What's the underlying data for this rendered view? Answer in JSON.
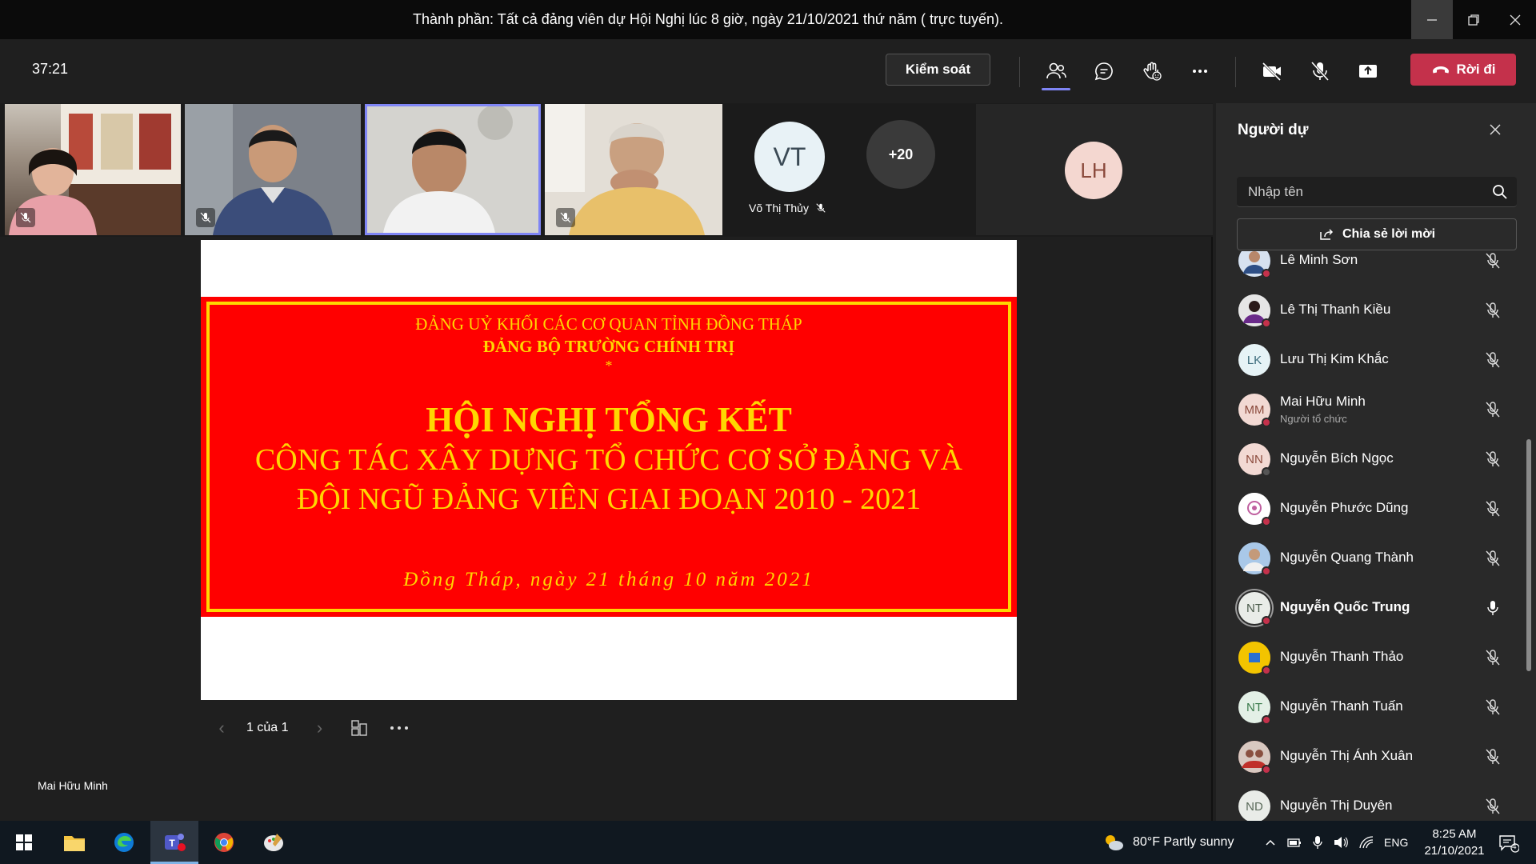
{
  "window": {
    "title": "Thành phần: Tất cả đảng viên dự Hội Nghị lúc 8 giờ, ngày 21/10/2021 thứ năm ( trực tuyến)."
  },
  "toolbar": {
    "timer": "37:21",
    "control_label": "Kiểm soát",
    "leave_label": "Rời đi"
  },
  "stage": {
    "tile_vt_initials": "VT",
    "tile_vt_name": "Võ Thị Thủy",
    "more_count": "+20",
    "tile_lh_initials": "LH",
    "presenter_name": "Mai Hữu Minh"
  },
  "slide": {
    "line1": "ĐẢNG UỶ KHỐI CÁC CƠ QUAN TỈNH ĐỒNG THÁP",
    "line2": "ĐẢNG BỘ TRƯỜNG CHÍNH TRỊ",
    "line3": "*",
    "line4": "HỘI NGHỊ TỔNG KẾT",
    "line5": "CÔNG TÁC XÂY DỰNG TỔ CHỨC CƠ SỞ ĐẢNG VÀ",
    "line6": "ĐỘI NGŨ ĐẢNG VIÊN GIAI ĐOẠN 2010 - 2021",
    "line7": "Đồng Tháp, ngày 21 tháng 10 năm 2021",
    "page_indicator": "1 của 1"
  },
  "panel": {
    "title": "Người dự",
    "search_placeholder": "Nhập tên",
    "share_invite_label": "Chia sẻ lời mời",
    "participants": [
      {
        "name": "Lê Minh Sơn",
        "initials": "",
        "role": "",
        "mic": "off"
      },
      {
        "name": "Lê Thị Thanh Kiều",
        "initials": "",
        "role": "",
        "mic": "off"
      },
      {
        "name": "Lưu Thị Kim Khắc",
        "initials": "LK",
        "role": "",
        "mic": "off"
      },
      {
        "name": "Mai Hữu Minh",
        "initials": "MM",
        "role": "Người tổ chức",
        "mic": "off"
      },
      {
        "name": "Nguyễn Bích Ngọc",
        "initials": "NN",
        "role": "",
        "mic": "off"
      },
      {
        "name": "Nguyễn Phước Dũng",
        "initials": "",
        "role": "",
        "mic": "off"
      },
      {
        "name": "Nguyễn Quang Thành",
        "initials": "",
        "role": "",
        "mic": "off"
      },
      {
        "name": "Nguyễn Quốc Trung",
        "initials": "NT",
        "role": "",
        "mic": "on"
      },
      {
        "name": "Nguyễn Thanh Thảo",
        "initials": "",
        "role": "",
        "mic": "off"
      },
      {
        "name": "Nguyễn Thanh Tuấn",
        "initials": "NT",
        "role": "",
        "mic": "off"
      },
      {
        "name": "Nguyễn Thị Ánh Xuân",
        "initials": "",
        "role": "",
        "mic": "off"
      },
      {
        "name": "Nguyễn Thị Duyên",
        "initials": "ND",
        "role": "",
        "mic": "off"
      }
    ]
  },
  "taskbar": {
    "weather": "80°F  Partly sunny",
    "lang": "ENG",
    "time": "8:25 AM",
    "date": "21/10/2021",
    "notif_count": "4"
  },
  "colors": {
    "accent": "#7f85f5",
    "leave": "#c4314b",
    "banner_red": "#ff0000",
    "banner_gold": "#ffd700"
  }
}
